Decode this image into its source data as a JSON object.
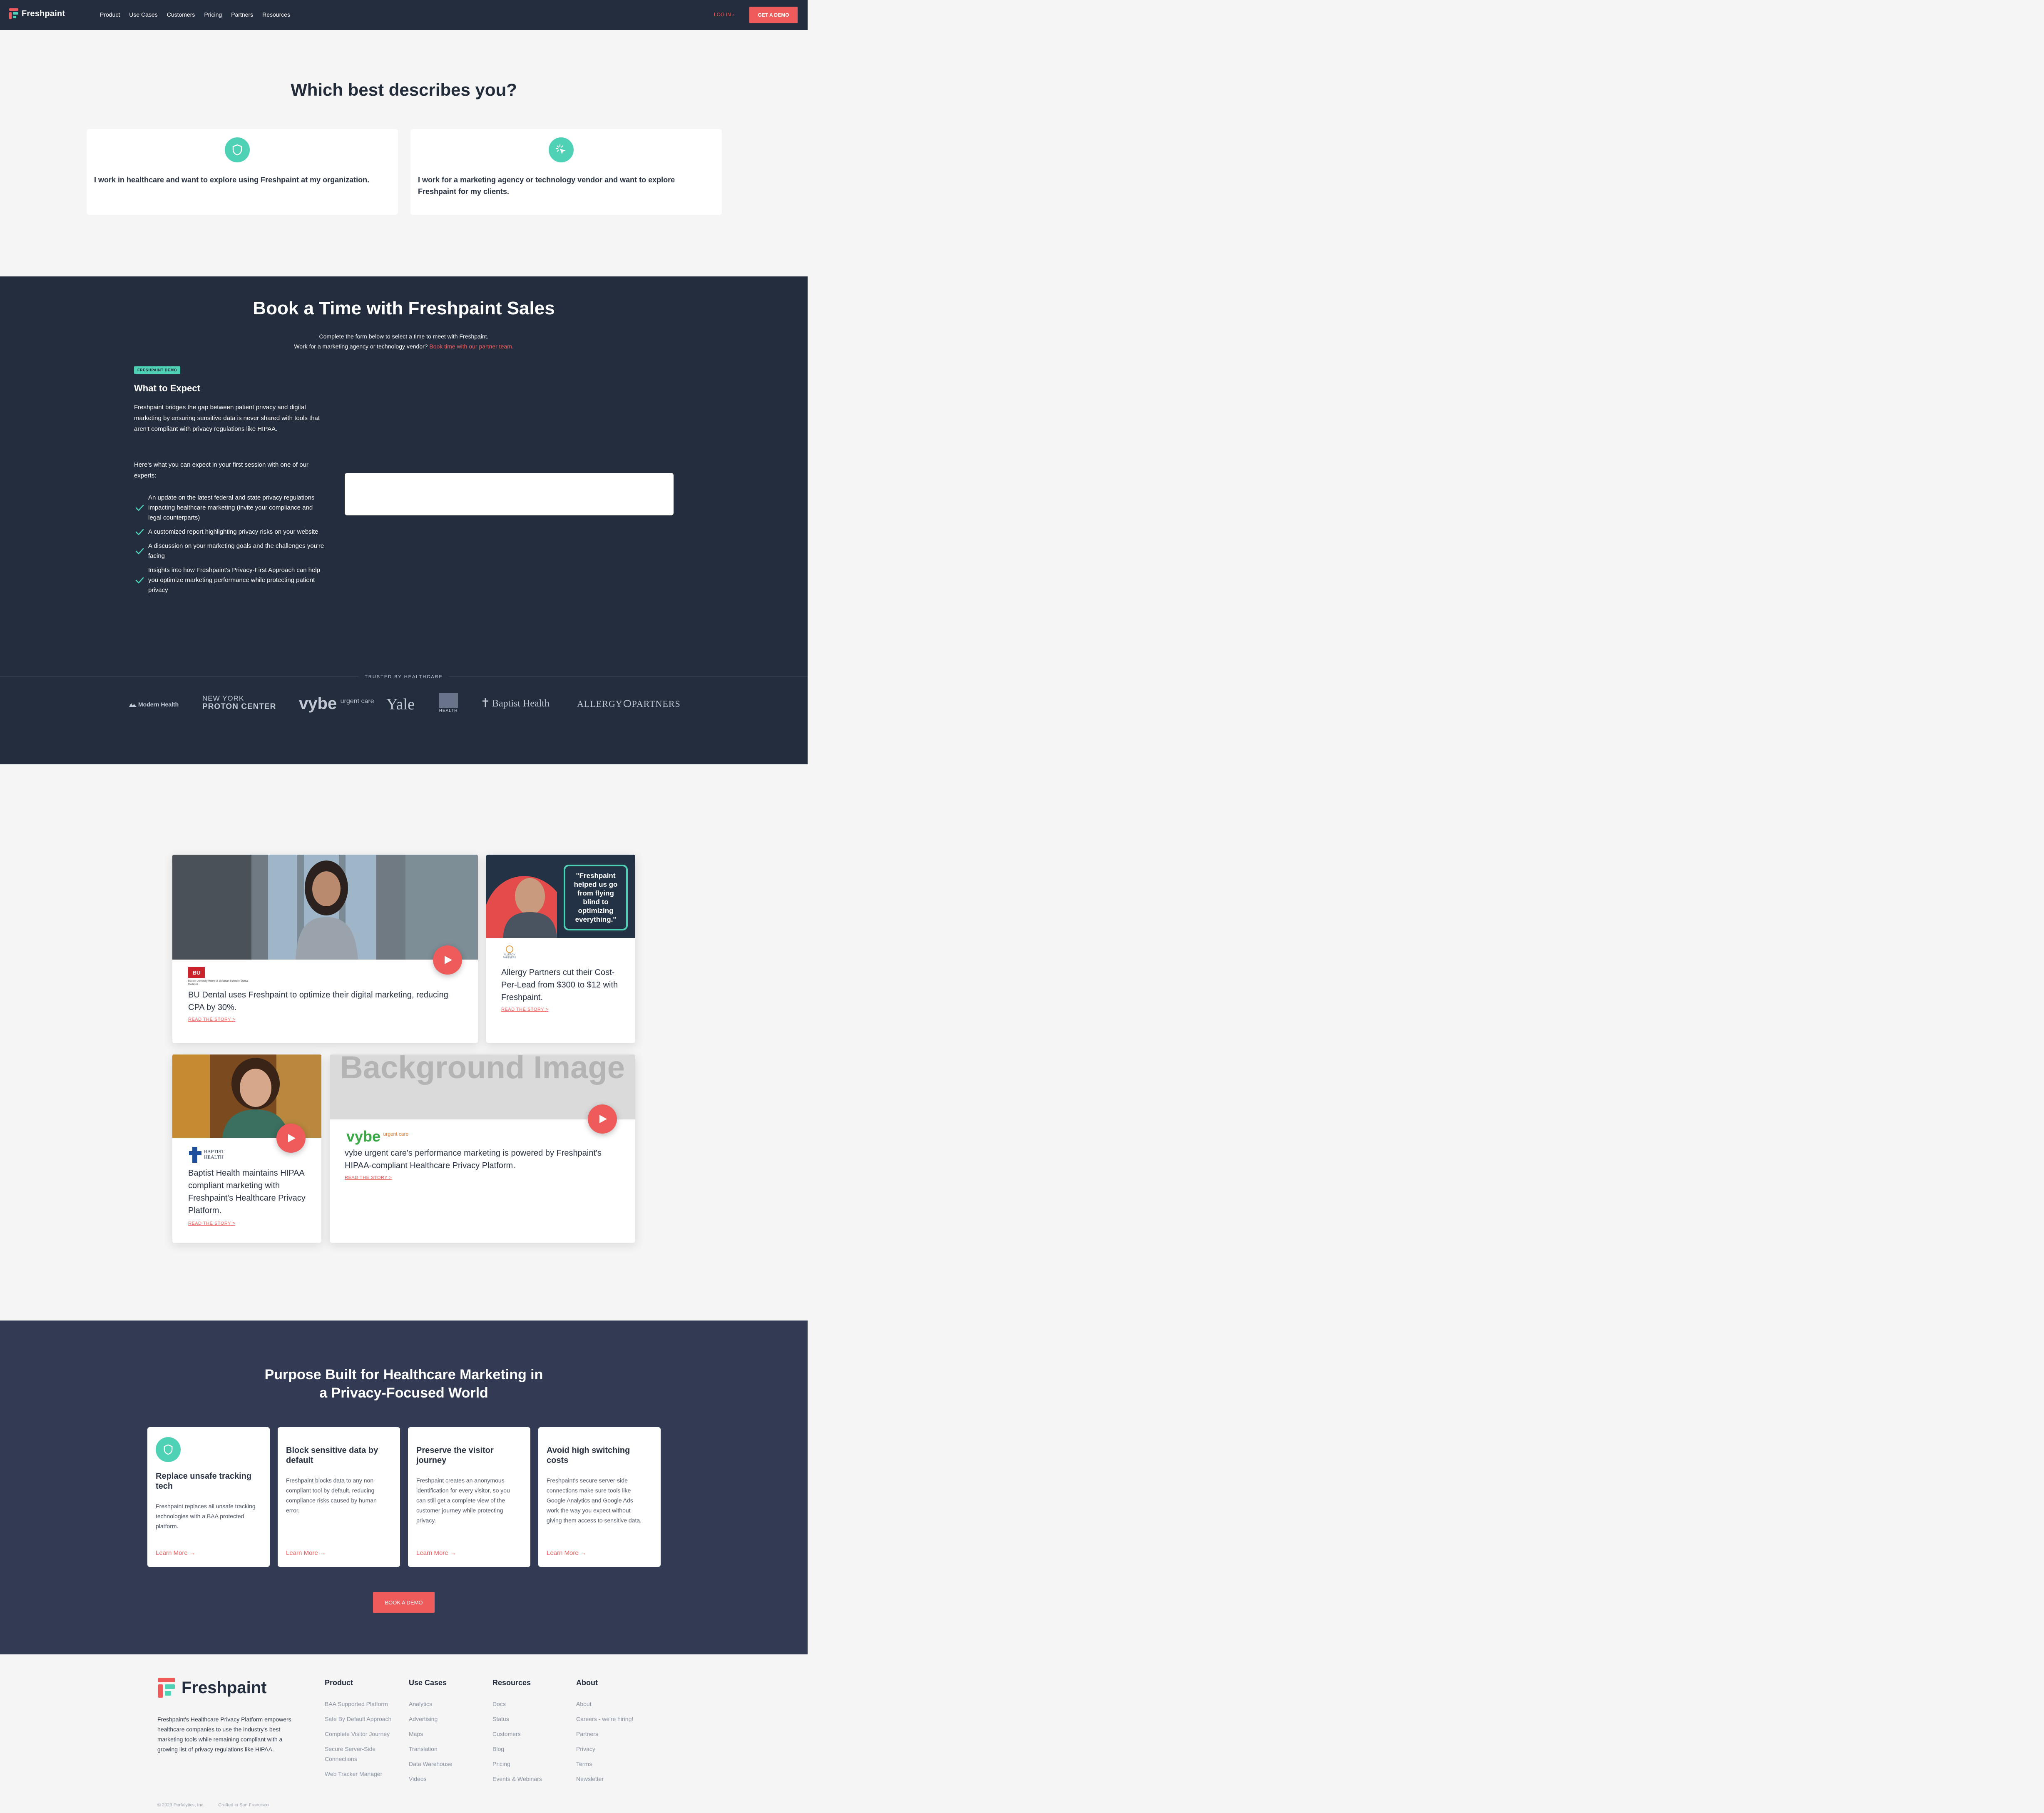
{
  "nav": {
    "logo_text": "Freshpaint",
    "links": [
      "Product",
      "Use Cases",
      "Customers",
      "Pricing",
      "Partners",
      "Resources"
    ],
    "login": "LOG IN ›",
    "demo_button": "GET A DEMO"
  },
  "audience": {
    "title": "Which best describes you?",
    "options": [
      {
        "icon": "shield-icon",
        "text": "I work in healthcare and want to explore using Freshpaint at my organization."
      },
      {
        "icon": "click-icon",
        "text": "I work for a marketing agency or technology vendor and want to explore Freshpaint for my clients."
      }
    ]
  },
  "book": {
    "title": "Book a Time with Freshpaint Sales",
    "sub_line1": "Complete the form below to select a time to meet with Freshpaint.",
    "sub_line2": "Work for a marketing agency or technology vendor?",
    "sub_link": "Book time with our partner team.",
    "badge": "FRESHPAINT DEMO",
    "expect_title": "What to Expect",
    "para1": "Freshpaint bridges the gap between patient privacy and digital marketing by ensuring sensitive data is never shared with tools that aren't compliant with privacy regulations like HIPAA.",
    "para2": "Here's what you can expect in your first session with one of our experts:",
    "checks": [
      "An update on the latest federal and state privacy regulations impacting healthcare marketing (invite your compliance and legal counterparts)",
      "A customized report highlighting privacy risks on your website",
      "A discussion on your marketing goals and the challenges you're facing",
      "Insights into how Freshpaint's Privacy-First Approach can help you optimize marketing performance while protecting patient privacy"
    ],
    "trusted_label": "TRUSTED BY HEALTHCARE",
    "logos": [
      "Modern Health",
      "NEW YORK",
      "PROTON CENTER",
      "vybe",
      "urgent care",
      "Yale",
      "HEALTH",
      "Baptist Health",
      "ALLERGY",
      "PARTNERS"
    ]
  },
  "stories": {
    "bu": {
      "logo": "BU",
      "logo_caption": "Boston University Henry M. Goldman School of Dental Medicine",
      "text": "BU Dental uses Freshpaint to optimize their digital marketing, reducing CPA by 30%.",
      "read": "READ THE STORY >"
    },
    "allergy": {
      "quote": "\"Freshpaint helped us go from flying blind to optimizing everything.\"",
      "logo": "ALLERGY PARTNERS",
      "text": "Allergy Partners cut their Cost-Per-Lead from $300 to $12 with Freshpaint.",
      "read": "READ THE STORY >"
    },
    "baptist": {
      "logo": "BAPTIST HEALTH",
      "text": "Baptist Health maintains HIPAA compliant marketing with Freshpaint's Healthcare Privacy Platform.",
      "read": "READ THE STORY >"
    },
    "vybe": {
      "bg_text": "Background Image",
      "logo": "vybe",
      "logo_sub": "urgent care",
      "text": "vybe urgent care's performance marketing is powered by Freshpaint's HIPAA-compliant Healthcare Privacy Platform.",
      "read": "READ THE STORY >"
    }
  },
  "purpose": {
    "title_line1": "Purpose Built for Healthcare Marketing in",
    "title_line2": "a Privacy-Focused World",
    "features": [
      {
        "title": "Replace unsafe tracking tech",
        "body": "Freshpaint replaces all unsafe tracking technologies with a BAA protected platform.",
        "link": "Learn More →"
      },
      {
        "title": "Block sensitive data by default",
        "body": "Freshpaint blocks data to any non-compliant tool by default, reducing compliance risks caused by human error.",
        "link": "Learn More →"
      },
      {
        "title": "Preserve the visitor journey",
        "body": "Freshpaint creates an anonymous identification for every visitor, so you can still get a complete view of the customer journey while protecting privacy.",
        "link": "Learn More →"
      },
      {
        "title": "Avoid high switching costs",
        "body": "Freshpaint's secure server-side connections make sure tools like Google Analytics and Google Ads work the way you expect without giving them access to sensitive data.",
        "link": "Learn More →"
      }
    ],
    "button": "BOOK A DEMO"
  },
  "footer": {
    "logo_text": "Freshpaint",
    "description": "Freshpaint's Healthcare Privacy Platform empowers healthcare companies to use the industry's best marketing tools while remaining compliant with a growing list of privacy regulations like HIPAA.",
    "columns": [
      {
        "title": "Product",
        "links": [
          "BAA Supported Platform",
          "Safe By Default Approach",
          "Complete Visitor Journey",
          "Secure Server-Side Connections",
          "Web Tracker Manager"
        ]
      },
      {
        "title": "Use Cases",
        "links": [
          "Analytics",
          "Advertising",
          "Maps",
          "Translation",
          "Data Warehouse",
          "Videos"
        ]
      },
      {
        "title": "Resources",
        "links": [
          "Docs",
          "Status",
          "Customers",
          "Blog",
          "Pricing",
          "Events & Webinars"
        ]
      },
      {
        "title": "About",
        "links": [
          "About",
          "Careers - we're hiring!",
          "Partners",
          "Privacy",
          "Terms",
          "Newsletter"
        ]
      }
    ],
    "copyright": "© 2023 Perfalytics, Inc.",
    "crafted": "Crafted in San Francisco"
  },
  "colors": {
    "nav_bg": "#232d3e",
    "accent": "#ef5b5b",
    "teal": "#4fd1b5",
    "purpose_bg": "#323a54",
    "page_bg": "#f5f5f5"
  }
}
